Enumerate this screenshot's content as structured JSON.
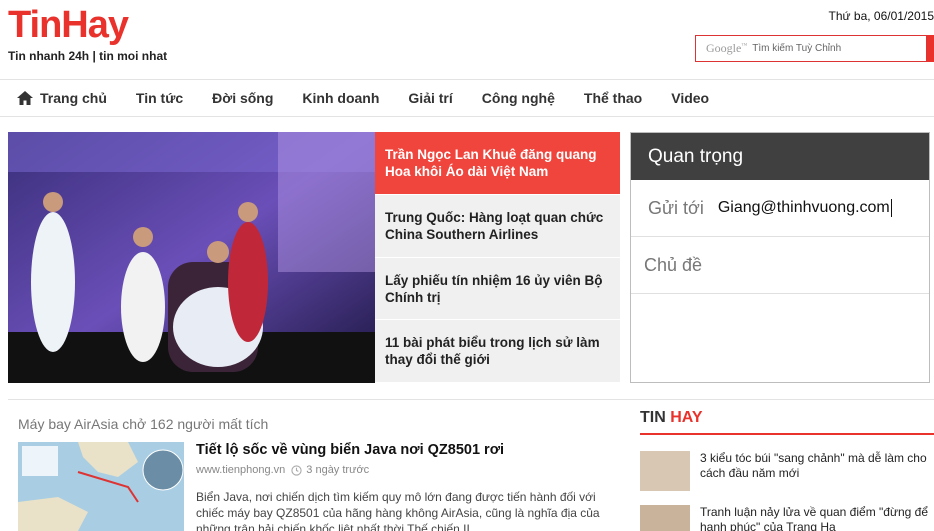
{
  "header": {
    "logo": "TinHay",
    "tagline": "Tin nhanh 24h | tin moi nhat",
    "date": "Thứ ba, 06/01/2015",
    "search": {
      "brand": "Google",
      "placeholder": "Tìm kiếm Tuỳ Chỉnh"
    }
  },
  "nav": {
    "items": [
      {
        "label": "Trang chủ",
        "icon": "home-icon"
      },
      {
        "label": "Tin tức"
      },
      {
        "label": "Đời sống"
      },
      {
        "label": "Kinh doanh"
      },
      {
        "label": "Giải trí"
      },
      {
        "label": "Công nghệ"
      },
      {
        "label": "Thể thao"
      },
      {
        "label": "Video"
      }
    ]
  },
  "featured": {
    "items": [
      {
        "title": "Trần Ngọc Lan Khuê đăng quang Hoa khôi Áo dài Việt Nam",
        "active": true
      },
      {
        "title": "Trung Quốc: Hàng loạt quan chức China Southern Airlines",
        "active": false
      },
      {
        "title": "Lấy phiếu tín nhiệm 16 ủy viên Bộ Chính trị",
        "active": false
      },
      {
        "title": "11 bài phát biểu trong lịch sử làm thay đổi thế giới",
        "active": false
      }
    ]
  },
  "compose": {
    "header": "Quan trọng",
    "to_label": "Gửi tới",
    "to_value": "Giang@thinhvuong.com",
    "subject_label": "Chủ đề"
  },
  "section": {
    "title": "Máy bay AirAsia chở 162 người mất tích",
    "article": {
      "title": "Tiết lộ sốc về vùng biển Java nơi QZ8501 rơi",
      "source": "www.tienphong.vn",
      "time": "3 ngày trước",
      "summary": "Biển Java, nơi chiến dịch tìm kiếm quy mô lớn đang được tiến hành đối với chiếc máy bay QZ8501 của hãng hàng không AirAsia, cũng là nghĩa địa của những trận hải chiến khốc liệt nhất thời Thế chiến II."
    }
  },
  "tinhay": {
    "head_tin": "TIN",
    "head_hay": "HAY",
    "items": [
      {
        "text": "3 kiểu tóc búi \"sang chảnh\" mà dễ làm cho cách đầu năm mới"
      },
      {
        "text": "Tranh luận nảy lửa về quan điểm \"đừng để hạnh phúc\" của Trang Hạ"
      }
    ]
  },
  "colors": {
    "brand": "#e8322b",
    "compose_header": "#404040"
  }
}
